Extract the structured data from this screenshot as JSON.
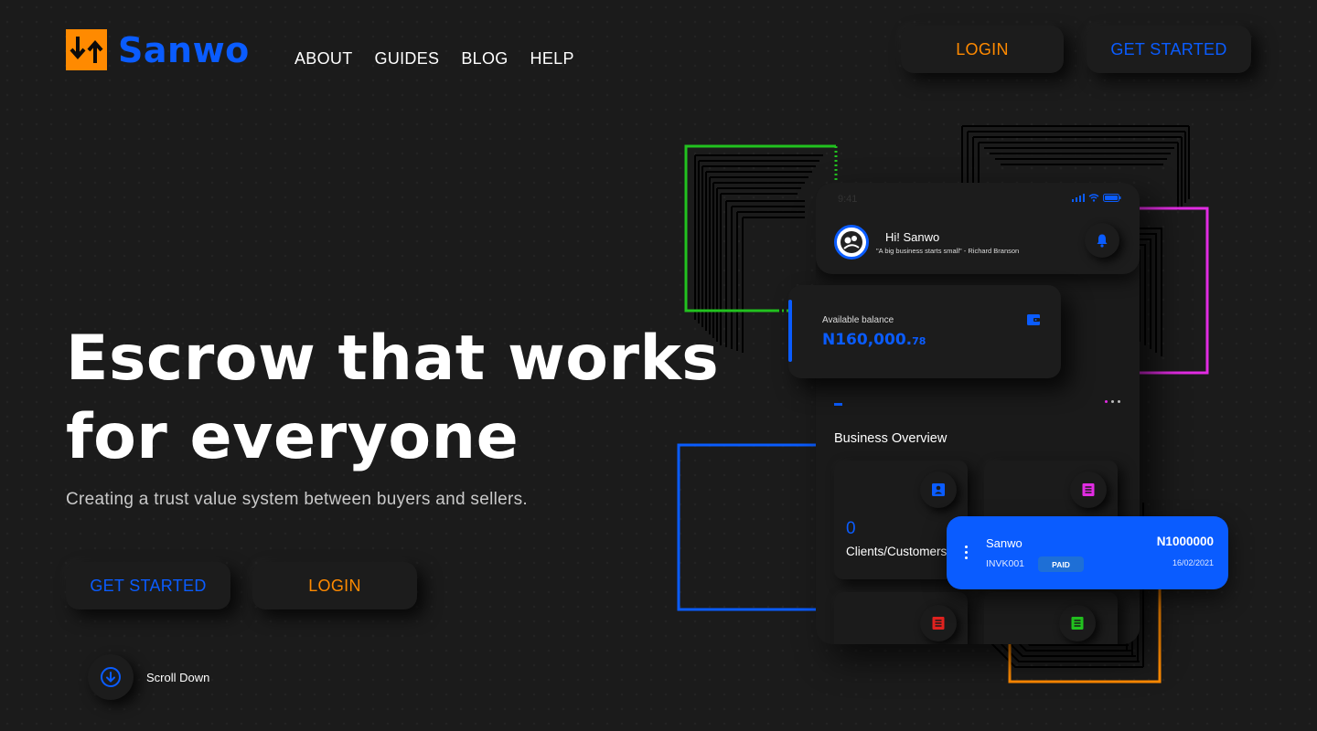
{
  "brand": {
    "name": "Sanwo",
    "logo_icon": "swap-arrows-icon",
    "color": "#0a5cff",
    "mark_color": "#ff8a00"
  },
  "nav": {
    "items": [
      "ABOUT",
      "GUIDES",
      "BLOG",
      "HELP"
    ]
  },
  "header_buttons": {
    "login": "LOGIN",
    "get_started": "GET STARTED"
  },
  "hero": {
    "title": "Escrow that works\nfor everyone",
    "subtitle": "Creating a trust value system between buyers and sellers.",
    "get_started": "GET STARTED",
    "login": "LOGIN",
    "scroll_label": "Scroll Down",
    "scroll_icon": "arrow-down-circle-icon"
  },
  "phone": {
    "status_time": "9:41",
    "greeting": "Hi! Sanwo",
    "quote": "\"A big business starts small\" - Richard Branson",
    "bell_icon": "bell-icon",
    "balance": {
      "label": "Available balance",
      "value": "N160,000.",
      "cents": "78",
      "icon": "wallet-icon"
    },
    "overview": {
      "title": "Business Overview",
      "tiles": [
        {
          "value": "0",
          "label": "Clients/Customers",
          "icon": "contact-card-icon",
          "icon_color": "#0a5cff"
        },
        {
          "value": "",
          "label": "",
          "icon": "receipt-icon",
          "icon_color": "#e22ce3"
        },
        {
          "value": "",
          "label": "",
          "icon": "receipt-icon",
          "icon_color": "#e0221f"
        },
        {
          "value": "",
          "label": "",
          "icon": "receipt-icon",
          "icon_color": "#22c21f"
        }
      ]
    }
  },
  "invoice": {
    "name": "Sanwo",
    "code": "INVK001",
    "status": "PAID",
    "amount": "N1000000",
    "date": "16/02/2021"
  },
  "colors": {
    "accent_blue": "#0a5cff",
    "accent_orange": "#ff8a00",
    "green": "#22c21f",
    "magenta": "#e22ce3",
    "background": "#1b1b1b"
  }
}
